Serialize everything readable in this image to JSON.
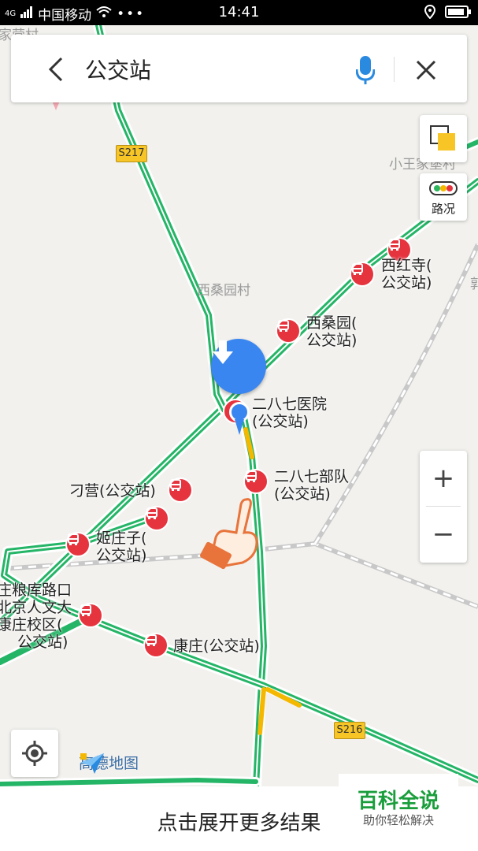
{
  "status": {
    "carrier": "中国移动",
    "network": "4G",
    "time": "14:41"
  },
  "search": {
    "back_icon": "chevron-left-icon",
    "query": "公交站",
    "mic_icon": "microphone-icon",
    "close_icon": "close-icon"
  },
  "map_controls": {
    "layers_icon": "layers-icon",
    "traffic_label": "路况",
    "zoom_in": "+",
    "zoom_out": "−",
    "locate_icon": "locate-icon"
  },
  "roads": {
    "s217": "S217",
    "s216": "S216"
  },
  "places": {
    "top_left": "家营村",
    "top_right": "小王家堡村",
    "xisangyuan_village": "西桑园村",
    "right_edge": "郭"
  },
  "stations": [
    {
      "line1": "西红寺(",
      "line2": "公交站)"
    },
    {
      "line1": "西桑园(",
      "line2": "公交站)"
    },
    {
      "line1": "二八七医院",
      "line2": "(公交站)"
    },
    {
      "line1": "二八七部队",
      "line2": "(公交站)"
    },
    {
      "line1": "刁营(公交站)"
    },
    {
      "line1": "姬庄子(",
      "line2": "公交站)"
    },
    {
      "line1": "庄粮库路口",
      "line2": "北京人文大",
      "line3": "康庄校区(",
      "line4": "公交站)"
    },
    {
      "line1": "康庄(公交站)"
    }
  ],
  "brand": {
    "map_logo": "高德地图"
  },
  "bottom_bar": {
    "expand_text": "点击展开更多结果"
  },
  "watermark": {
    "title": "百科全说",
    "subtitle": "助你轻松解决"
  },
  "colors": {
    "road_green": "#25b567",
    "road_yellow": "#f5b800",
    "bus_red": "#e6343f",
    "marker_blue": "#3a86f0",
    "watermark_green": "#1a9e3c"
  }
}
